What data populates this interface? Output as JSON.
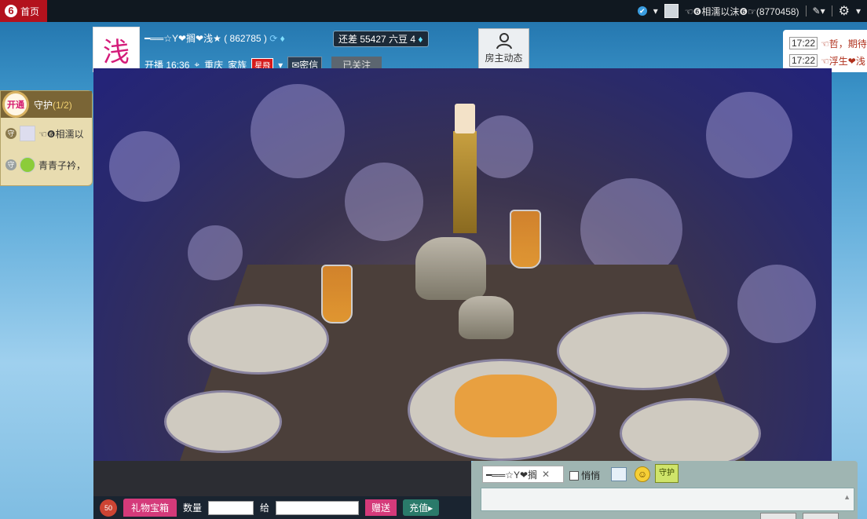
{
  "topbar": {
    "home_label": "首页",
    "home_logo": "6",
    "username": "☜❻相濡以沫❻☞(8770458)"
  },
  "anchor": {
    "avatar_char": "浅",
    "name": "━══☆Y❤搁❤浅★ ( 862785 )",
    "rank_text": "还差 55427 六豆 4",
    "live_time": "开播 16:36",
    "location": "重庆",
    "family_label": "家族",
    "star_badge": "星飛",
    "message_label": "密信",
    "follow_label": "已关注",
    "owner_label": "房主动态"
  },
  "right_feed": [
    {
      "time": "17:22",
      "who": "☜哲，期待"
    },
    {
      "time": "17:22",
      "who": "☜浮生❤浅"
    }
  ],
  "guard": {
    "open_label": "开通",
    "title": "守护",
    "count": "(1/2)",
    "members": [
      {
        "name": "☜❻相濡以",
        "shield": "守"
      },
      {
        "name": "青青子衿，",
        "shield": "守"
      }
    ]
  },
  "bottom": {
    "gift_count": "50",
    "gift_store_label": "礼物宝箱",
    "qty_label": "数量",
    "to_label": "给",
    "send_label": "赠送",
    "charge_label": "充值"
  },
  "chat": {
    "target": "━══☆Y❤搁",
    "whisper_label": "悄悄",
    "guard_chat": "守护"
  },
  "colors": {
    "home_red": "#b3121d",
    "video_tint": "#23237a",
    "accent_pink": "#d43a7a"
  }
}
